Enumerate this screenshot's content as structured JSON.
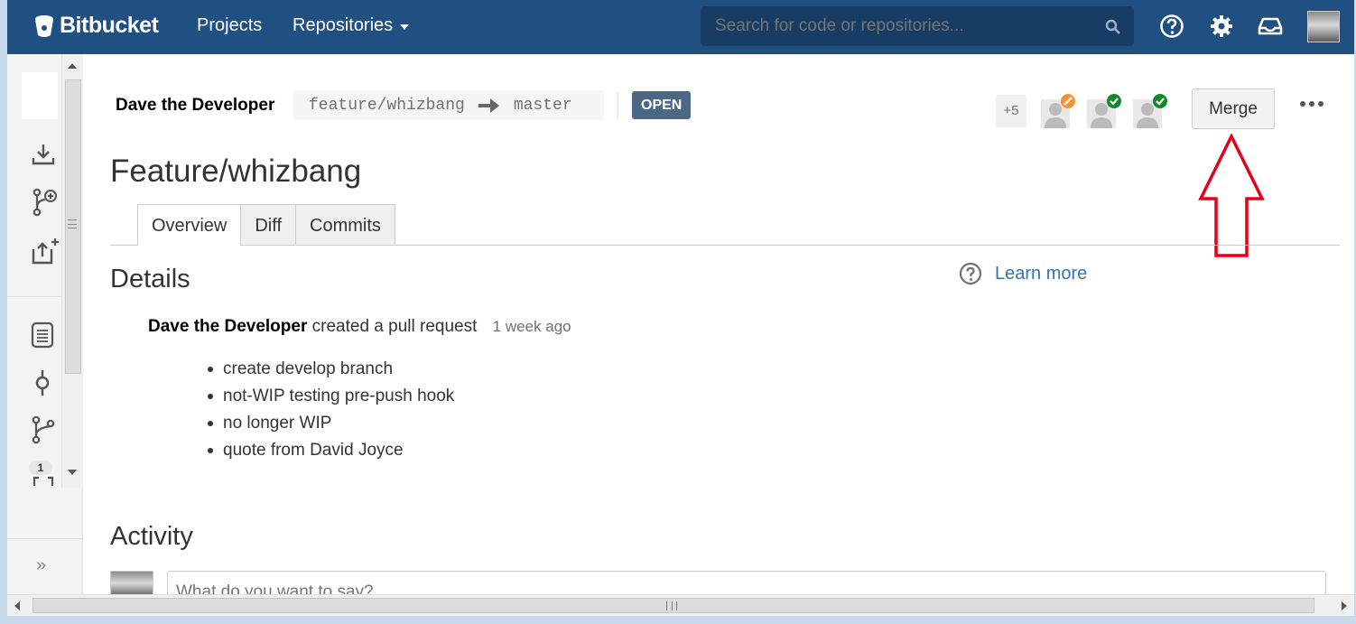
{
  "topbar": {
    "brand": "Bitbucket",
    "nav_projects": "Projects",
    "nav_repositories": "Repositories",
    "search_placeholder": "Search for code or repositories..."
  },
  "sidebar": {
    "badge_count": "1",
    "expand": "»"
  },
  "pull_request": {
    "author": "Dave the Developer",
    "source_branch": "feature/whizbang",
    "target_branch": "master",
    "status": "OPEN",
    "extra_reviewers": "+5",
    "merge_label": "Merge",
    "title": "Feature/whizbang",
    "tabs": [
      "Overview",
      "Diff",
      "Commits"
    ],
    "details_heading": "Details",
    "learn_more": "Learn more",
    "created_author": "Dave the Developer",
    "created_action": "created a pull request",
    "created_time": "1 week ago",
    "commits": [
      "create develop branch",
      "not-WIP testing pre-push hook",
      "no longer WIP",
      "quote from David Joyce"
    ],
    "activity_heading": "Activity",
    "comment_placeholder": "What do you want to say?"
  },
  "colors": {
    "header": "#205081",
    "link": "#3572b0",
    "status_badge": "#4a6785",
    "annotation": "#e3001b",
    "approved": "#14892c",
    "needs_work": "#f79232"
  },
  "icons": {
    "reviewers": [
      "needs-work-icon",
      "approved-icon",
      "approved-icon"
    ]
  }
}
